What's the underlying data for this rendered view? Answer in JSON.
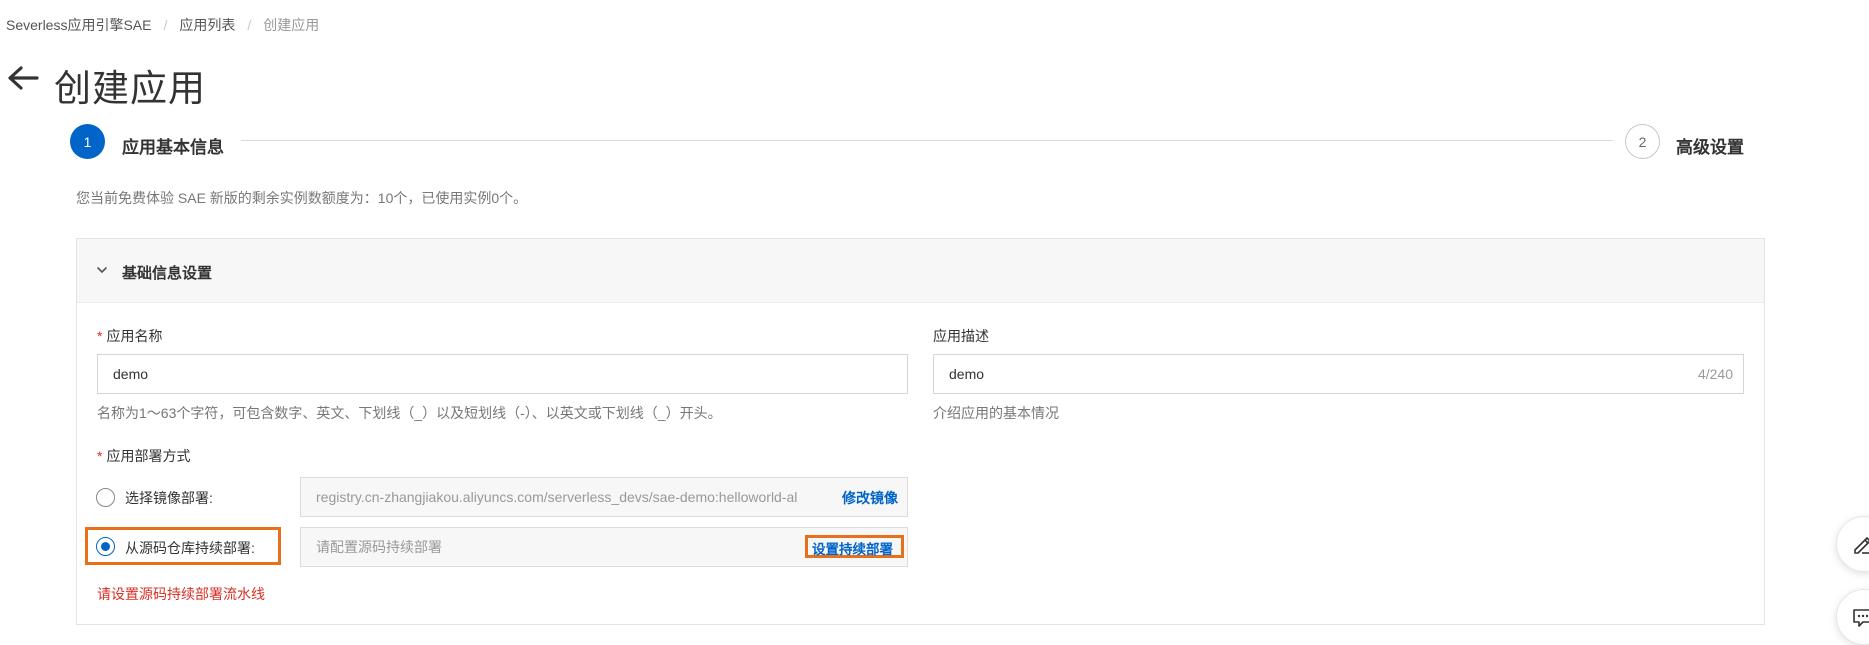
{
  "breadcrumb": {
    "items": [
      "Severless应用引擎SAE",
      "应用列表",
      "创建应用"
    ]
  },
  "page": {
    "title": "创建应用"
  },
  "steps": [
    {
      "number": "1",
      "label": "应用基本信息",
      "state": "active"
    },
    {
      "number": "2",
      "label": "高级设置",
      "state": "pending"
    }
  ],
  "quota_text": "您当前免费体验 SAE 新版的剩余实例数额度为：10个，已使用实例0个。",
  "panel": {
    "title": "基础信息设置"
  },
  "form": {
    "app_name": {
      "required_mark": "*",
      "label": "应用名称",
      "value": "demo",
      "help": "名称为1～63个字符，可包含数字、英文、下划线（_）以及短划线（-）、以英文或下划线（_）开头。"
    },
    "app_desc": {
      "label": "应用描述",
      "value": "demo",
      "counter": "4/240",
      "help": "介绍应用的基本情况"
    },
    "deploy": {
      "required_mark": "*",
      "label": "应用部署方式",
      "options": [
        {
          "label": "选择镜像部署:",
          "checked": false,
          "field_value": "registry.cn-zhangjiakou.aliyuncs.com/serverless_devs/sae-demo:helloworld-al",
          "action": "修改镜像"
        },
        {
          "label": "从源码仓库持续部署:",
          "checked": true,
          "field_placeholder": "请配置源码持续部署",
          "action": "设置持续部署"
        }
      ],
      "error": "请设置源码持续部署流水线"
    }
  },
  "colors": {
    "primary": "#0064c8",
    "error": "#d93026",
    "highlight": "#e8701a"
  },
  "floating_actions": [
    {
      "icon": "edit-icon"
    },
    {
      "icon": "chat-icon"
    }
  ]
}
